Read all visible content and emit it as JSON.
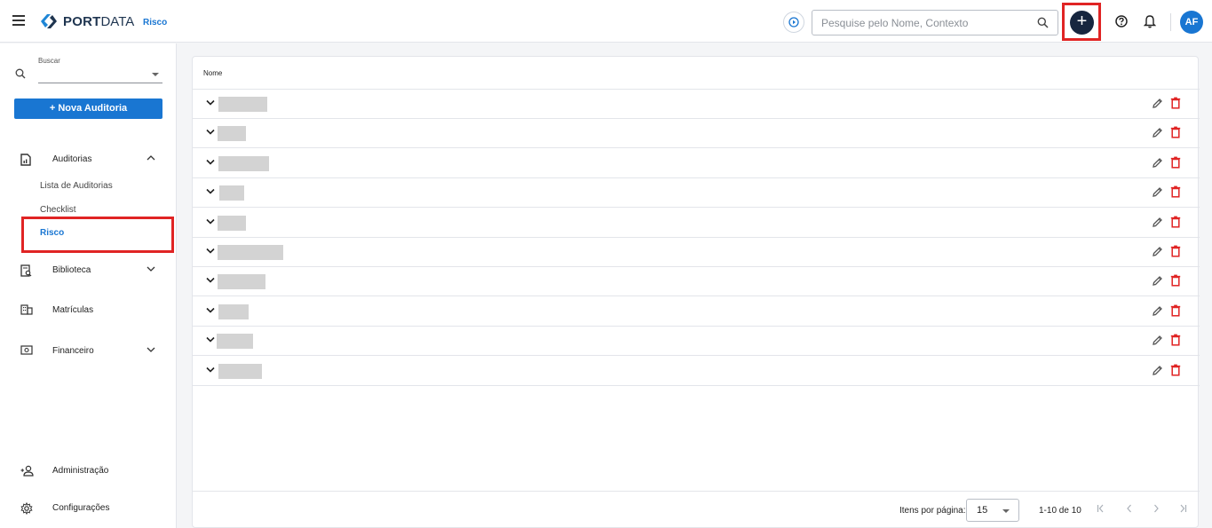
{
  "header": {
    "brand_bold": "PORT",
    "brand_light": "DATA",
    "breadcrumb": "Risco",
    "search_placeholder": "Pesquise pelo Nome, Contexto",
    "add_label": "+",
    "avatar_initials": "AF"
  },
  "sidebar": {
    "search_label": "Buscar",
    "new_button": "+ Nova Auditoria",
    "auditorias": {
      "label": "Auditorias",
      "children": [
        "Lista de Auditorias",
        "Checklist",
        "Risco"
      ]
    },
    "biblioteca": "Biblioteca",
    "matriculas": "Matrículas",
    "financeiro": "Financeiro",
    "administracao": "Administração",
    "configuracoes": "Configurações"
  },
  "table": {
    "column_header": "Nome",
    "row_count": 10
  },
  "pagination": {
    "items_per_page_label": "Itens por página:",
    "items_per_page_value": "15",
    "range_label": "1-10 de 10"
  },
  "colors": {
    "primary": "#1976d2",
    "brand_dark": "#1f3550",
    "add_button": "#17263f",
    "delete_red": "#e02424",
    "highlight_red": "#e02424"
  }
}
